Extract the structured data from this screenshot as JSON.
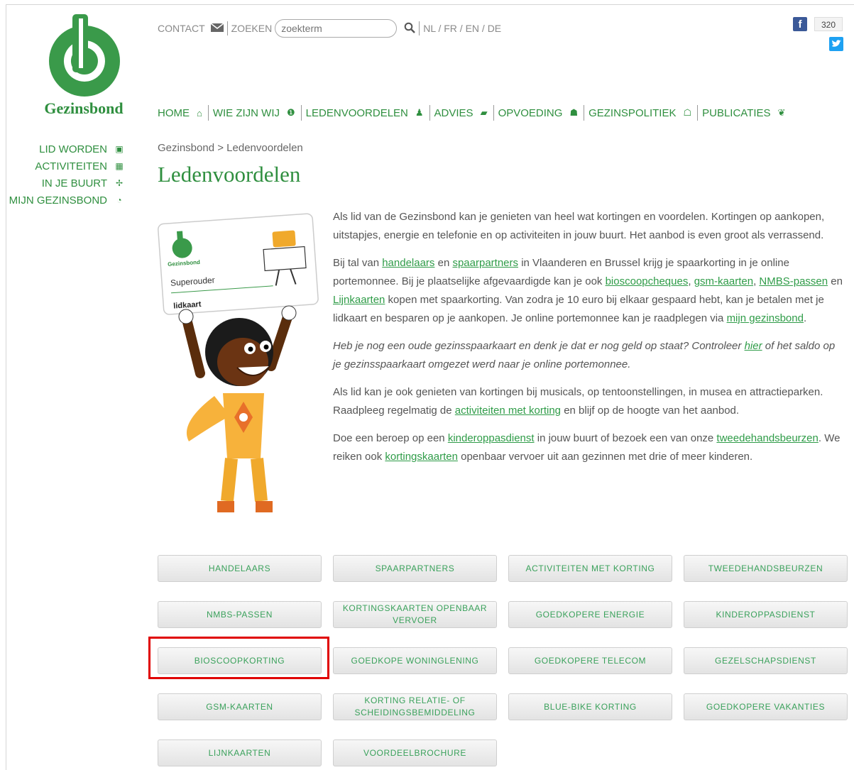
{
  "brand": {
    "name": "Gezinsbond"
  },
  "topbar": {
    "contact": "CONTACT",
    "search_label": "ZOEKEN",
    "search_placeholder": "zoekterm",
    "languages": "NL / FR / EN / DE"
  },
  "social": {
    "facebook_letter": "f",
    "facebook_count": "320"
  },
  "main_nav": [
    {
      "label": "HOME",
      "icon": "home-icon",
      "glyph": "⌂"
    },
    {
      "label": "WIE ZIJN WIJ",
      "icon": "info-icon",
      "glyph": "❶"
    },
    {
      "label": "LEDENVOORDELEN",
      "icon": "person-icon",
      "glyph": "♟"
    },
    {
      "label": "ADVIES",
      "icon": "chat-icon",
      "glyph": "▰"
    },
    {
      "label": "OPVOEDING",
      "icon": "child-icon",
      "glyph": "☗"
    },
    {
      "label": "GEZINSPOLITIEK",
      "icon": "family-icon",
      "glyph": "☖"
    },
    {
      "label": "PUBLICATIES",
      "icon": "leaf-icon",
      "glyph": "❦"
    }
  ],
  "side_nav": [
    {
      "label": "LID WORDEN",
      "icon": "card-icon",
      "glyph": "▣"
    },
    {
      "label": "ACTIVITEITEN",
      "icon": "calendar-icon",
      "glyph": "▦"
    },
    {
      "label": "IN JE BUURT",
      "icon": "signpost-icon",
      "glyph": "✢"
    },
    {
      "label": "MIJN GEZINSBOND",
      "icon": "logo-mini-icon",
      "glyph": "◔"
    }
  ],
  "breadcrumb": {
    "home": "Gezinsbond",
    "sep": " > ",
    "current": "Ledenvoordelen"
  },
  "page_title": "Ledenvoordelen",
  "card": {
    "brand": "Gezinsbond",
    "name": "Superouder",
    "type": "lidkaart"
  },
  "content": {
    "p1": "Als lid van de Gezinsbond kan je genieten van heel wat kortingen en voordelen. Kortingen op aankopen, uitstapjes, energie en telefonie en op activiteiten in jouw buurt. Het aanbod is even groot als verrassend.",
    "p2": {
      "t1": "Bij tal van ",
      "l1": "handelaars",
      "t2": " en ",
      "l2": "spaarpartners",
      "t3": " in Vlaanderen en Brussel krijg je spaarkorting in je online portemonnee. Bij je plaatselijke afgevaardigde kan je ook ",
      "l3": "bioscoopcheques",
      "t4": ", ",
      "l4": "gsm-kaarten",
      "t5": ", ",
      "l5": "NMBS-passen",
      "t6": " en ",
      "l6": "Lijnkaarten",
      "t7": " kopen met spaarkorting. Van zodra je 10 euro bij elkaar gespaard hebt, kan je betalen met je lidkaart en  besparen op je aankopen. Je online portemonnee kan je raadplegen via ",
      "l7": "mijn gezinsbond",
      "t8": "."
    },
    "p3": {
      "t1": "Heb je nog een oude gezinsspaarkaart en denk je dat er nog geld op staat? Controleer ",
      "l1": "hier",
      "t2": " of het saldo op je gezinsspaarkaart omgezet werd naar je online portemonnee."
    },
    "p4": {
      "t1": "Als lid kan je ook genieten van kortingen bij musicals, op tentoonstellingen, in musea en attractieparken. Raadpleeg regelmatig de ",
      "l1": "activiteiten met korting",
      "t2": " en blijf op de hoogte van het aanbod."
    },
    "p5": {
      "t1": "Doe een beroep op een ",
      "l1": "kinderoppasdienst",
      "t2": " in jouw buurt of bezoek een van onze ",
      "l2": "tweedehandsbeurzen",
      "t3": ". We reiken ook ",
      "l3": "kortingskaarten",
      "t4": " openbaar vervoer uit aan gezinnen met drie of meer kinderen."
    }
  },
  "buttons": [
    "HANDELAARS",
    "SPAARPARTNERS",
    "ACTIVITEITEN MET KORTING",
    "TWEEDEHANDSBEURZEN",
    "NMBS-PASSEN",
    "KORTINGSKAARTEN OPENBAAR VERVOER",
    "GOEDKOPERE ENERGIE",
    "KINDEROPPASDIENST",
    "BIOSCOOPKORTING",
    "GOEDKOPE WONINGLENING",
    "GOEDKOPERE TELECOM",
    "GEZELSCHAPSDIENST",
    "GSM-KAARTEN",
    "KORTING RELATIE- OF SCHEIDINGSBEMIDDELING",
    "BLUE-BIKE KORTING",
    "GOEDKOPERE VAKANTIES",
    "LIJNKAARTEN",
    "VOORDEELBROCHURE"
  ],
  "colors": {
    "brand_green": "#2f8f3f",
    "link_green": "#2f9c48",
    "highlight": "#e00000"
  }
}
